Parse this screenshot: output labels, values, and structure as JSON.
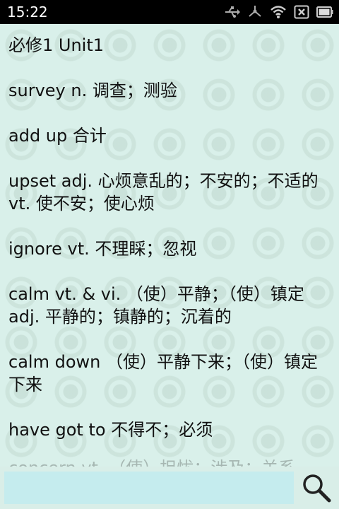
{
  "status_bar": {
    "time": "15:22",
    "icons": [
      "usb-icon",
      "share-icon",
      "wifi-icon",
      "sim-error-icon",
      "battery-icon"
    ]
  },
  "vocabulary": {
    "heading": "必修1 Unit1",
    "entries": [
      "survey  n. 调查；测验",
      "add up  合计",
      "upset  adj. 心烦意乱的；不安的；不适的 vt. 使不安；使心烦",
      "ignore  vt. 不理睬；忽视",
      "calm  vt. & vi. （使）平静；（使）镇定 adj. 平静的；镇静的；沉着的",
      "calm down  （使）平静下来；（使）镇定下来",
      "have got to  不得不；必须"
    ],
    "partial_entry": "concern vt. （使）担忧；涉及；关系"
  },
  "search": {
    "value": "",
    "placeholder": ""
  },
  "colors": {
    "background": "#d9f0ea",
    "status_bar": "#000000",
    "search_field": "#c5ecee",
    "text": "#111111"
  }
}
